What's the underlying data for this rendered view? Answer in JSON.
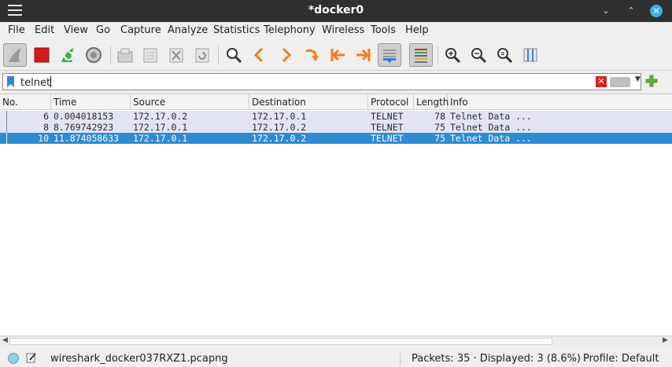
{
  "window": {
    "title": "*docker0"
  },
  "menu": [
    {
      "label": "File"
    },
    {
      "label": "Edit"
    },
    {
      "label": "View"
    },
    {
      "label": "Go"
    },
    {
      "label": "Capture"
    },
    {
      "label": "Analyze"
    },
    {
      "label": "Statistics"
    },
    {
      "label": "Telephony"
    },
    {
      "label": "Wireless"
    },
    {
      "label": "Tools"
    },
    {
      "label": "Help"
    }
  ],
  "toolbar": {
    "icons": [
      "shark-fin-icon",
      "stop-icon",
      "restart-icon",
      "options-gear-icon",
      "open-folder-icon",
      "save-icon",
      "close-file-icon",
      "reload-icon",
      "find-icon",
      "back-icon",
      "forward-icon",
      "go-to-packet-icon",
      "first-packet-icon",
      "last-packet-icon",
      "autoscroll-icon",
      "colorize-icon",
      "zoom-in-icon",
      "zoom-out-icon",
      "zoom-reset-icon",
      "resize-columns-icon"
    ]
  },
  "filter": {
    "value": "telnet"
  },
  "columns": [
    "No.",
    "Time",
    "Source",
    "Destination",
    "Protocol",
    "Length",
    "Info"
  ],
  "packets": [
    {
      "no": "6",
      "time": "0.004018153",
      "source": "172.17.0.2",
      "destination": "172.17.0.1",
      "protocol": "TELNET",
      "length": "78",
      "info": "Telnet Data ..."
    },
    {
      "no": "8",
      "time": "8.769742923",
      "source": "172.17.0.1",
      "destination": "172.17.0.2",
      "protocol": "TELNET",
      "length": "75",
      "info": "Telnet Data ..."
    },
    {
      "no": "10",
      "time": "11.874058633",
      "source": "172.17.0.1",
      "destination": "172.17.0.2",
      "protocol": "TELNET",
      "length": "75",
      "info": "Telnet Data ..."
    }
  ],
  "selected_row": 2,
  "status": {
    "file": "wireshark_docker037RXZ1.pcapng",
    "packets": "Packets: 35 · Displayed: 3 (8.6%)",
    "profile": "Profile: Default"
  },
  "colors": {
    "row_bg": "#e4e4f8",
    "selected_bg": "#2f8bd0",
    "title_bg": "#2f2f2f",
    "close_btn": "#3daee9"
  }
}
